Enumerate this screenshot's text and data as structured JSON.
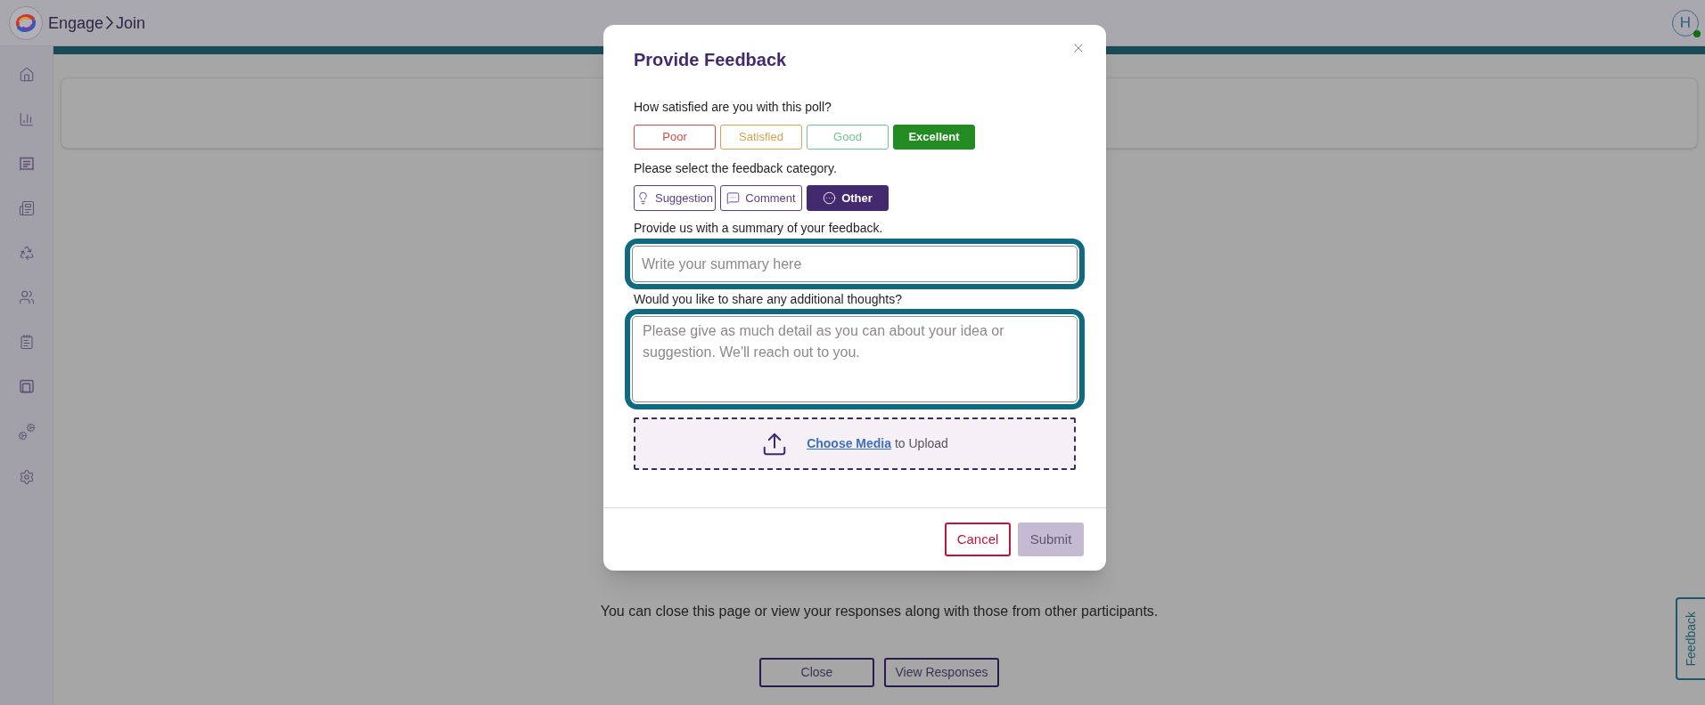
{
  "header": {
    "breadcrumb": [
      {
        "label": "Engage"
      },
      {
        "label": "Join"
      }
    ],
    "avatar": {
      "initial": "H",
      "online": true
    }
  },
  "page": {
    "message": "You can close this page or view your responses along with those from other participants.",
    "buttons": [
      "Close",
      "View Responses"
    ]
  },
  "feedback_tab": {
    "label": "Feedback"
  },
  "dialog": {
    "title": "Provide Feedback",
    "rating_prompt": "How satisfied are you with this poll?",
    "ratings": [
      {
        "label": "Poor",
        "color": "#d64a45",
        "selected": false
      },
      {
        "label": "Satisfied",
        "color": "#d6a24e",
        "selected": false
      },
      {
        "label": "Good",
        "color": "#6fc58c",
        "selected": false
      },
      {
        "label": "Excellent",
        "color": "#228b22",
        "selected": true
      }
    ],
    "category_prompt": "Please select the feedback category.",
    "categories": [
      {
        "label": "Suggestion",
        "selected": false
      },
      {
        "label": "Comment",
        "selected": false
      },
      {
        "label": "Other",
        "selected": true
      }
    ],
    "summary": {
      "label": "Provide us with a summary of your feedback.",
      "placeholder": "Write your summary here",
      "highlighted": true
    },
    "details": {
      "label": "Would you like to share any additional thoughts?",
      "placeholder": "Please give as much detail as you can about your idea or suggestion. We'll reach out to you.",
      "highlighted": true
    },
    "upload": {
      "link": "Choose Media",
      "text": "to Upload"
    },
    "buttons": [
      {
        "label": "Cancel",
        "kind": "cancel",
        "disabled": false
      },
      {
        "label": "Submit",
        "kind": "submit",
        "disabled": true
      }
    ]
  }
}
